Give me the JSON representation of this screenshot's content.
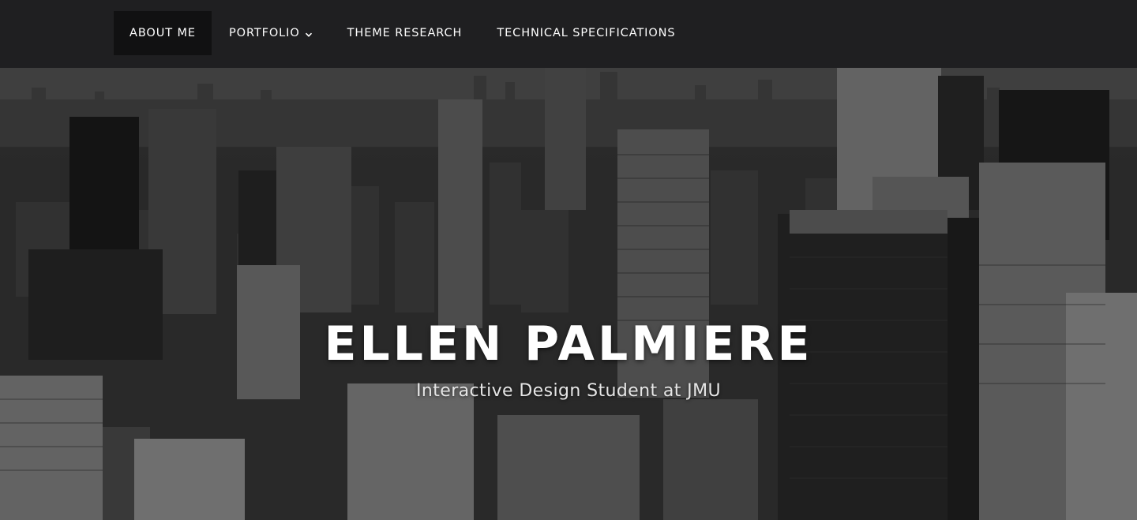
{
  "nav": {
    "items": [
      {
        "label": "ABOUT ME"
      },
      {
        "label": "PORTFOLIO"
      },
      {
        "label": "THEME RESEARCH"
      },
      {
        "label": "TECHNICAL SPECIFICATIONS"
      }
    ],
    "active_item": "ABOUT ME",
    "portfolio_icon": "chevron-down-icon"
  },
  "hero": {
    "title": "ELLEN PALMIERE",
    "subtitle": "Interactive Design Student at JMU",
    "background_image": "grayscale city skyline"
  },
  "colors": {
    "navbar_bg": "#1f1f21",
    "active_tab_bg": "#111112",
    "text": "#ffffff"
  }
}
